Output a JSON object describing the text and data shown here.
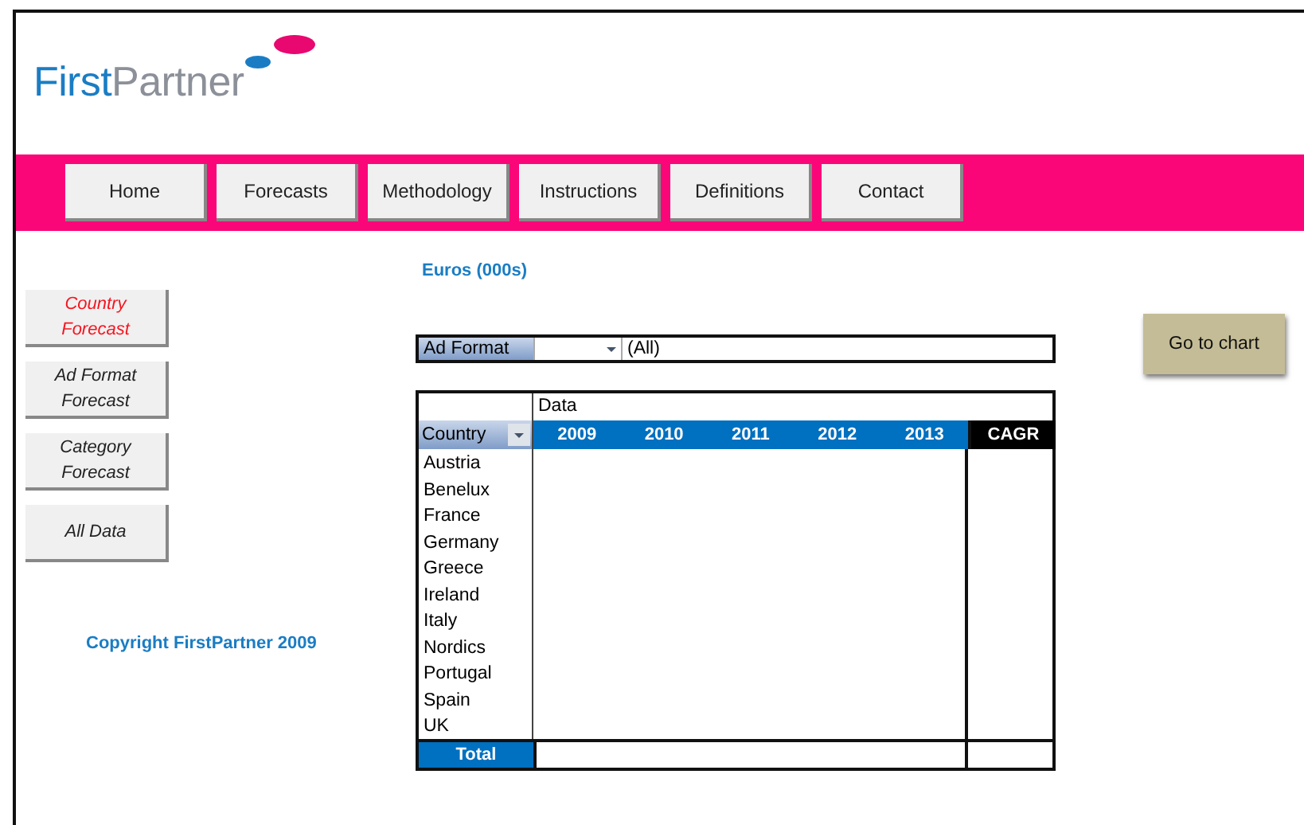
{
  "logo": {
    "first": "First",
    "second": "Partner"
  },
  "nav": [
    "Home",
    "Forecasts",
    "Methodology",
    "Instructions",
    "Definitions",
    "Contact"
  ],
  "side_buttons": [
    {
      "label": "Country Forecast",
      "selected": true
    },
    {
      "label": "Ad Format Forecast",
      "selected": false
    },
    {
      "label": "Category Forecast",
      "selected": false
    },
    {
      "label": "All Data",
      "selected": false
    }
  ],
  "copyright": "Copyright FirstPartner 2009",
  "units": "Euros (000s)",
  "filter": {
    "label": "Ad Format",
    "value": "(All)"
  },
  "go_button": "Go to chart",
  "table": {
    "data_label": "Data",
    "row_field": "Country",
    "columns": [
      "2009",
      "2010",
      "2011",
      "2012",
      "2013"
    ],
    "cagr": "CAGR",
    "rows": [
      "Austria",
      "Benelux",
      "France",
      "Germany",
      "Greece",
      "Ireland",
      "Italy",
      "Nordics",
      "Portugal",
      "Spain",
      "UK"
    ],
    "total": "Total"
  }
}
